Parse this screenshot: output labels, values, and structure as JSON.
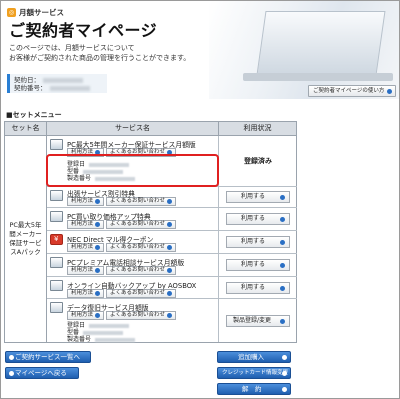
{
  "header": {
    "service_tag": "月額サービス",
    "page_title": "ご契約者マイページ",
    "intro_line1": "このページでは、月額サービスについて",
    "intro_line2": "お客様がご契約された商品の管理を行うことができます。",
    "info_label1": "契約日：",
    "info_label2": "契約番号：",
    "help_button": "ご契約者マイページの使い方"
  },
  "menu_heading": "■セットメニュー",
  "table": {
    "headers": [
      "セット名",
      "サービス名",
      "利用状況"
    ],
    "set_name": "PC最大5年間メーカー保証サービスAパック",
    "rows": [
      {
        "name": "PC最大5年間メーカー保証サービス月額版",
        "status": "登録済み",
        "detail_labels": [
          "登録日",
          "型番",
          "製造番号"
        ]
      },
      {
        "name": "出張サービス割引特典",
        "status": "利用する"
      },
      {
        "name": "PC買い取り価格アップ特典",
        "status": "利用する"
      },
      {
        "name": "NEC Direct マル得クーポン",
        "status": "利用する"
      },
      {
        "name": "PCプレミアム電話相談サービス月額版",
        "status": "利用する"
      },
      {
        "name": "オンライン自動バックアップ by AOSBOX",
        "status": "利用する"
      },
      {
        "name": "データ復旧サービス月額版",
        "status": "製品登録/変更",
        "detail_labels": [
          "登録日",
          "型番",
          "製造番号"
        ]
      }
    ],
    "btn_usage": "利用方法",
    "btn_faq": "よくあるお問い合わせ"
  },
  "bottom": {
    "list_button": "ご契約サービス一覧へ",
    "back_button": "マイページへ戻る",
    "add_button": "追加購入",
    "card_button": "クレジットカード情報変更",
    "cancel_button": "解　約"
  },
  "colors": {
    "accent": "#2a6fc4",
    "highlight": "#e02020",
    "header_row": "#d8dde3"
  }
}
